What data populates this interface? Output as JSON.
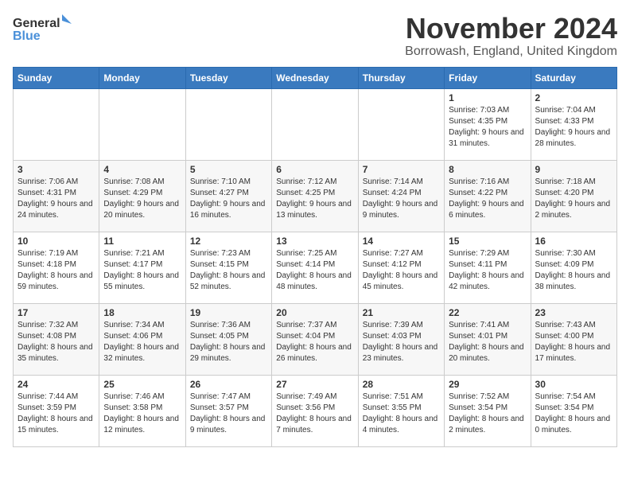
{
  "logo": {
    "line1": "General",
    "line2": "Blue"
  },
  "title": "November 2024",
  "location": "Borrowash, England, United Kingdom",
  "weekdays": [
    "Sunday",
    "Monday",
    "Tuesday",
    "Wednesday",
    "Thursday",
    "Friday",
    "Saturday"
  ],
  "weeks": [
    [
      {
        "day": "",
        "info": ""
      },
      {
        "day": "",
        "info": ""
      },
      {
        "day": "",
        "info": ""
      },
      {
        "day": "",
        "info": ""
      },
      {
        "day": "",
        "info": ""
      },
      {
        "day": "1",
        "info": "Sunrise: 7:03 AM\nSunset: 4:35 PM\nDaylight: 9 hours and 31 minutes."
      },
      {
        "day": "2",
        "info": "Sunrise: 7:04 AM\nSunset: 4:33 PM\nDaylight: 9 hours and 28 minutes."
      }
    ],
    [
      {
        "day": "3",
        "info": "Sunrise: 7:06 AM\nSunset: 4:31 PM\nDaylight: 9 hours and 24 minutes."
      },
      {
        "day": "4",
        "info": "Sunrise: 7:08 AM\nSunset: 4:29 PM\nDaylight: 9 hours and 20 minutes."
      },
      {
        "day": "5",
        "info": "Sunrise: 7:10 AM\nSunset: 4:27 PM\nDaylight: 9 hours and 16 minutes."
      },
      {
        "day": "6",
        "info": "Sunrise: 7:12 AM\nSunset: 4:25 PM\nDaylight: 9 hours and 13 minutes."
      },
      {
        "day": "7",
        "info": "Sunrise: 7:14 AM\nSunset: 4:24 PM\nDaylight: 9 hours and 9 minutes."
      },
      {
        "day": "8",
        "info": "Sunrise: 7:16 AM\nSunset: 4:22 PM\nDaylight: 9 hours and 6 minutes."
      },
      {
        "day": "9",
        "info": "Sunrise: 7:18 AM\nSunset: 4:20 PM\nDaylight: 9 hours and 2 minutes."
      }
    ],
    [
      {
        "day": "10",
        "info": "Sunrise: 7:19 AM\nSunset: 4:18 PM\nDaylight: 8 hours and 59 minutes."
      },
      {
        "day": "11",
        "info": "Sunrise: 7:21 AM\nSunset: 4:17 PM\nDaylight: 8 hours and 55 minutes."
      },
      {
        "day": "12",
        "info": "Sunrise: 7:23 AM\nSunset: 4:15 PM\nDaylight: 8 hours and 52 minutes."
      },
      {
        "day": "13",
        "info": "Sunrise: 7:25 AM\nSunset: 4:14 PM\nDaylight: 8 hours and 48 minutes."
      },
      {
        "day": "14",
        "info": "Sunrise: 7:27 AM\nSunset: 4:12 PM\nDaylight: 8 hours and 45 minutes."
      },
      {
        "day": "15",
        "info": "Sunrise: 7:29 AM\nSunset: 4:11 PM\nDaylight: 8 hours and 42 minutes."
      },
      {
        "day": "16",
        "info": "Sunrise: 7:30 AM\nSunset: 4:09 PM\nDaylight: 8 hours and 38 minutes."
      }
    ],
    [
      {
        "day": "17",
        "info": "Sunrise: 7:32 AM\nSunset: 4:08 PM\nDaylight: 8 hours and 35 minutes."
      },
      {
        "day": "18",
        "info": "Sunrise: 7:34 AM\nSunset: 4:06 PM\nDaylight: 8 hours and 32 minutes."
      },
      {
        "day": "19",
        "info": "Sunrise: 7:36 AM\nSunset: 4:05 PM\nDaylight: 8 hours and 29 minutes."
      },
      {
        "day": "20",
        "info": "Sunrise: 7:37 AM\nSunset: 4:04 PM\nDaylight: 8 hours and 26 minutes."
      },
      {
        "day": "21",
        "info": "Sunrise: 7:39 AM\nSunset: 4:03 PM\nDaylight: 8 hours and 23 minutes."
      },
      {
        "day": "22",
        "info": "Sunrise: 7:41 AM\nSunset: 4:01 PM\nDaylight: 8 hours and 20 minutes."
      },
      {
        "day": "23",
        "info": "Sunrise: 7:43 AM\nSunset: 4:00 PM\nDaylight: 8 hours and 17 minutes."
      }
    ],
    [
      {
        "day": "24",
        "info": "Sunrise: 7:44 AM\nSunset: 3:59 PM\nDaylight: 8 hours and 15 minutes."
      },
      {
        "day": "25",
        "info": "Sunrise: 7:46 AM\nSunset: 3:58 PM\nDaylight: 8 hours and 12 minutes."
      },
      {
        "day": "26",
        "info": "Sunrise: 7:47 AM\nSunset: 3:57 PM\nDaylight: 8 hours and 9 minutes."
      },
      {
        "day": "27",
        "info": "Sunrise: 7:49 AM\nSunset: 3:56 PM\nDaylight: 8 hours and 7 minutes."
      },
      {
        "day": "28",
        "info": "Sunrise: 7:51 AM\nSunset: 3:55 PM\nDaylight: 8 hours and 4 minutes."
      },
      {
        "day": "29",
        "info": "Sunrise: 7:52 AM\nSunset: 3:54 PM\nDaylight: 8 hours and 2 minutes."
      },
      {
        "day": "30",
        "info": "Sunrise: 7:54 AM\nSunset: 3:54 PM\nDaylight: 8 hours and 0 minutes."
      }
    ]
  ]
}
